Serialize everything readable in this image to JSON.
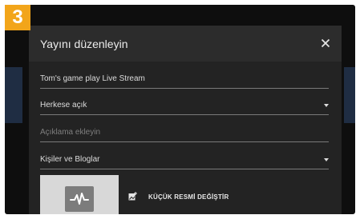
{
  "step_badge": "3",
  "dialog": {
    "title": "Yayını düzenleyin",
    "close_icon": "close-icon",
    "fields": {
      "stream_title": {
        "value": "Tom's game play Live Stream"
      },
      "privacy": {
        "value": "Herkese açık",
        "icon": "dropdown-caret-icon"
      },
      "description": {
        "placeholder": "Açıklama ekleyin"
      },
      "category": {
        "value": "Kişiler ve Bloglar",
        "icon": "dropdown-caret-icon"
      }
    },
    "thumbnail": {
      "icon": "waveform-icon",
      "change_icon": "image-add-icon",
      "change_label": "KÜÇÜK RESMİ DEĞİŞTİR"
    }
  },
  "colors": {
    "badge": "#f2a51a",
    "dialog_background": "#232323",
    "dialog_header": "#2c2c2c",
    "screen_background": "#0e0e0e"
  }
}
